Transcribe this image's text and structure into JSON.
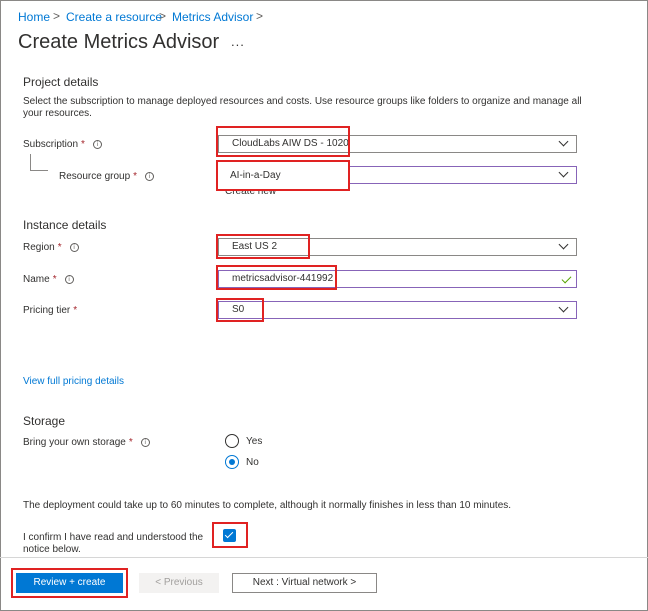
{
  "breadcrumb": {
    "items": [
      "Home",
      "Create a resource",
      "Metrics Advisor"
    ],
    "separator": ">"
  },
  "page": {
    "title": "Create Metrics Advisor",
    "more": "..."
  },
  "project": {
    "heading": "Project details",
    "description": "Select the subscription to manage deployed resources and costs. Use resource groups like folders to organize and manage all your resources.",
    "subscription": {
      "label": "Subscription",
      "required": "*",
      "value": "CloudLabs AIW DS - 1020"
    },
    "resource_group": {
      "label": "Resource group",
      "required": "*",
      "value": "AI-in-a-Day",
      "create_new": "Create new"
    }
  },
  "instance": {
    "heading": "Instance details",
    "region": {
      "label": "Region",
      "required": "*",
      "value": "East US 2"
    },
    "name": {
      "label": "Name",
      "required": "*",
      "value": "metricsadvisor-441992"
    },
    "pricing_tier": {
      "label": "Pricing tier",
      "required": "*",
      "value": "S0"
    },
    "pricing_link": "View full pricing details"
  },
  "storage": {
    "heading": "Storage",
    "byos": {
      "label": "Bring your own storage",
      "required": "*",
      "options": [
        "Yes",
        "No"
      ],
      "selected": "No"
    }
  },
  "notice": "The deployment could take up to 60 minutes to complete, although it normally finishes in less than 10 minutes.",
  "confirm": {
    "label_line1": "I confirm I have read and understood the",
    "label_line2": "notice below.",
    "checked": true
  },
  "footer": {
    "review_create": "Review + create",
    "previous": "< Previous",
    "next": "Next : Virtual network >"
  },
  "icons": {
    "info": "info-icon",
    "dropdown": "chevron-down-icon",
    "valid": "checkmark-icon"
  },
  "colors": {
    "accent": "#0078d4",
    "highlight": "#e02222",
    "valid": "#57a300",
    "required": "#a4262c"
  }
}
